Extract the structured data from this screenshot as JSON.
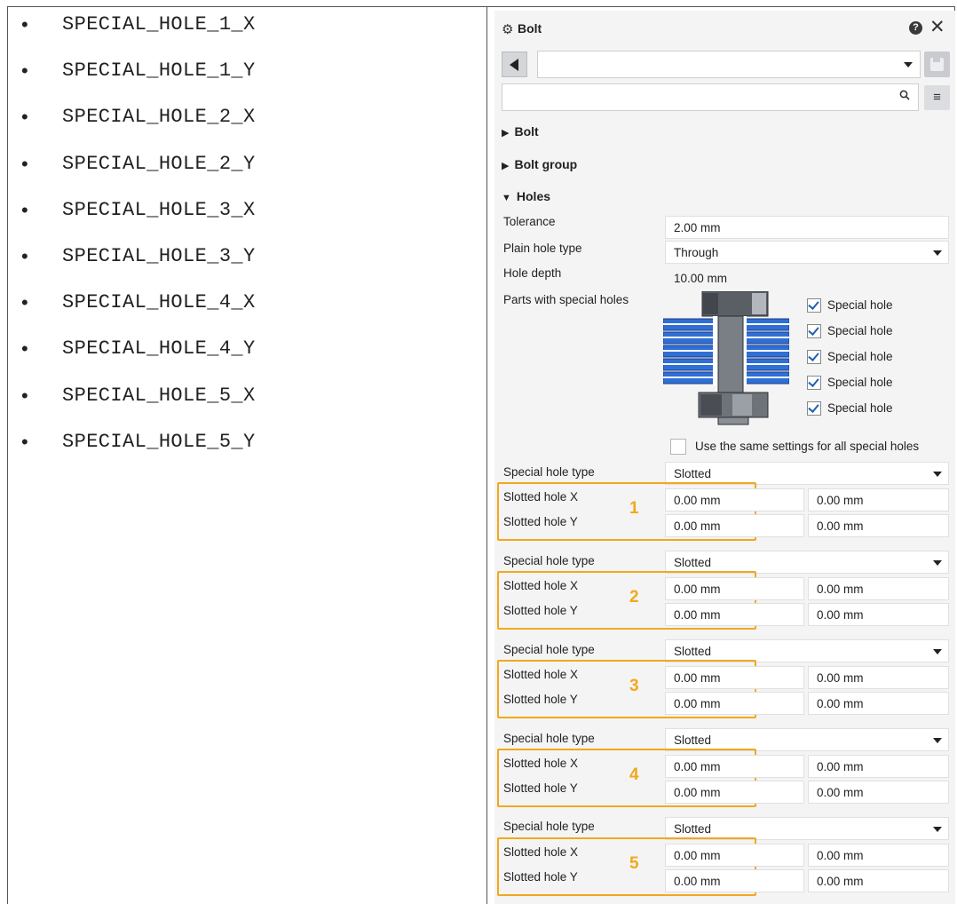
{
  "left_list": {
    "items": [
      "SPECIAL_HOLE_1_X",
      "SPECIAL_HOLE_1_Y",
      "SPECIAL_HOLE_2_X",
      "SPECIAL_HOLE_2_Y",
      "SPECIAL_HOLE_3_X",
      "SPECIAL_HOLE_3_Y",
      "SPECIAL_HOLE_4_X",
      "SPECIAL_HOLE_4_Y",
      "SPECIAL_HOLE_5_X",
      "SPECIAL_HOLE_5_Y"
    ],
    "bullet": "•"
  },
  "panel": {
    "title": "Bolt",
    "icons": {
      "title": "gear-icon",
      "help": "help-icon",
      "close": "close-icon",
      "back": "back-arrow-icon",
      "save": "save-icon",
      "search": "search-icon",
      "menu": "menu-icon"
    },
    "glyphs": {
      "gear": "⚙",
      "help": "?",
      "close": "✕",
      "search": "🔍",
      "menu": "≡"
    },
    "preset_value": "",
    "search": {
      "value": "",
      "placeholder": ""
    },
    "sections": {
      "bolt": {
        "label": "Bolt",
        "arrow": "▶"
      },
      "bolt_group": {
        "label": "Bolt group",
        "arrow": "▶"
      },
      "holes": {
        "label": "Holes",
        "arrow": "▼"
      }
    },
    "holes": {
      "tolerance": {
        "label": "Tolerance",
        "value": "2.00 mm"
      },
      "plain_hole_type": {
        "label": "Plain hole type",
        "value": "Through"
      },
      "hole_depth": {
        "label": "Hole depth",
        "value": "10.00 mm"
      },
      "parts_with_special_holes": {
        "label": "Parts with special holes",
        "checkboxes": [
          {
            "label": "Special hole",
            "checked": true
          },
          {
            "label": "Special hole",
            "checked": true
          },
          {
            "label": "Special hole",
            "checked": true
          },
          {
            "label": "Special hole",
            "checked": true
          },
          {
            "label": "Special hole",
            "checked": true
          }
        ]
      },
      "same_settings": {
        "label": "Use the same settings for all special holes",
        "checked": false
      },
      "special_groups": [
        {
          "number": "1",
          "type_label": "Special hole type",
          "type_value": "Slotted",
          "x_label": "Slotted hole X",
          "y_label": "Slotted hole Y",
          "x_values": [
            "0.00 mm",
            "0.00 mm"
          ],
          "y_values": [
            "0.00 mm",
            "0.00 mm"
          ]
        },
        {
          "number": "2",
          "type_label": "Special hole type",
          "type_value": "Slotted",
          "x_label": "Slotted hole X",
          "y_label": "Slotted hole Y",
          "x_values": [
            "0.00 mm",
            "0.00 mm"
          ],
          "y_values": [
            "0.00 mm",
            "0.00 mm"
          ]
        },
        {
          "number": "3",
          "type_label": "Special hole type",
          "type_value": "Slotted",
          "x_label": "Slotted hole X",
          "y_label": "Slotted hole Y",
          "x_values": [
            "0.00 mm",
            "0.00 mm"
          ],
          "y_values": [
            "0.00 mm",
            "0.00 mm"
          ]
        },
        {
          "number": "4",
          "type_label": "Special hole type",
          "type_value": "Slotted",
          "x_label": "Slotted hole X",
          "y_label": "Slotted hole Y",
          "x_values": [
            "0.00 mm",
            "0.00 mm"
          ],
          "y_values": [
            "0.00 mm",
            "0.00 mm"
          ]
        },
        {
          "number": "5",
          "type_label": "Special hole type",
          "type_value": "Slotted",
          "x_label": "Slotted hole X",
          "y_label": "Slotted hole Y",
          "x_values": [
            "0.00 mm",
            "0.00 mm"
          ],
          "y_values": [
            "0.00 mm",
            "0.00 mm"
          ]
        }
      ]
    },
    "colors": {
      "highlight": "#f2a81d",
      "plate_blue": "#2f6fd6",
      "bolt_grey": "#6e737a",
      "check_blue": "#1b62b8"
    }
  }
}
